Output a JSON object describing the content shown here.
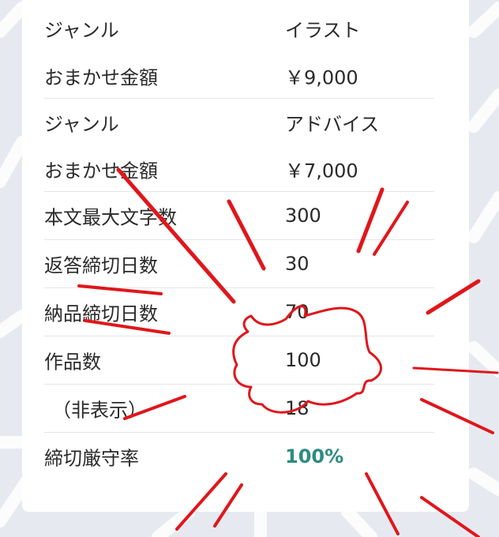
{
  "rows": [
    {
      "label": "ジャンル",
      "value": "イラスト"
    },
    {
      "label": "おまかせ金額",
      "value": "￥9,000"
    },
    {
      "label": "ジャンル",
      "value": "アドバイス"
    },
    {
      "label": "おまかせ金額",
      "value": "￥7,000"
    },
    {
      "label": "本文最大文字数",
      "value": "300"
    },
    {
      "label": "返答締切日数",
      "value": "30"
    },
    {
      "label": "納品締切日数",
      "value": "70"
    },
    {
      "label": "作品数",
      "value": "100"
    },
    {
      "label": "（非表示）",
      "value": "18"
    },
    {
      "label": "締切厳守率",
      "value": "100%"
    }
  ],
  "colors": {
    "accent": "#2e8b80",
    "emphasis_strokes": "#e0161b",
    "background": "#e6eaf0"
  },
  "annotation_icon": "speech-burst-icon"
}
